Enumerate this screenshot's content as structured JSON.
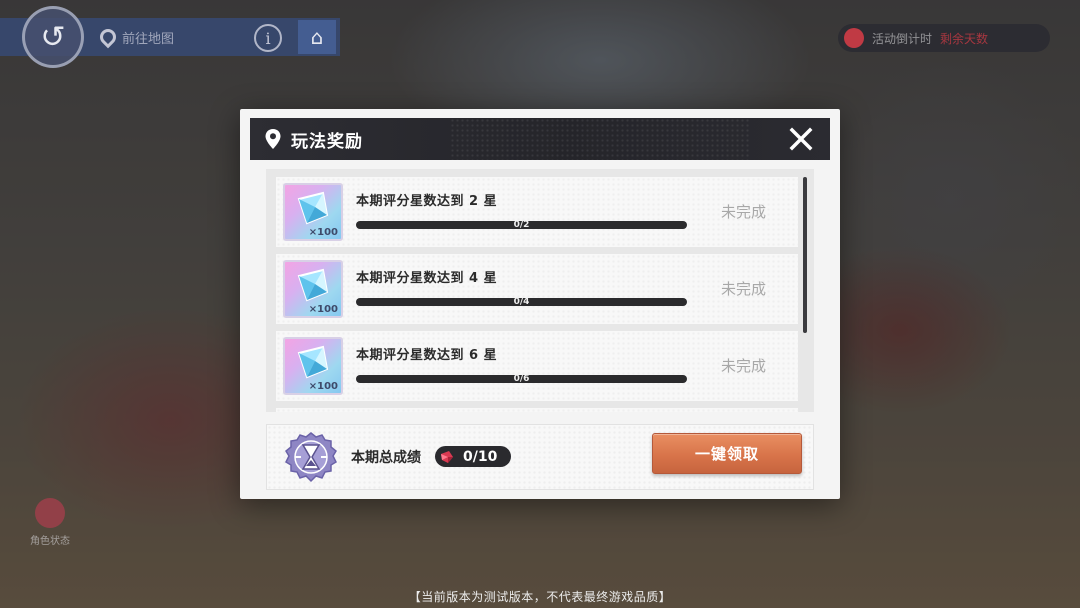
{
  "hud": {
    "location_label": "前往地图",
    "right_label": "活动倒计时",
    "right_highlight": "剩余天数",
    "left_char_label": "角色状态"
  },
  "modal": {
    "title": "玩法奖励",
    "tasks": [
      {
        "text": "本期评分星数达到 2 星",
        "progress_text": "0/2",
        "progress": 0.0,
        "status": "未完成",
        "reward_qty": "×100"
      },
      {
        "text": "本期评分星数达到 4 星",
        "progress_text": "0/4",
        "progress": 0.0,
        "status": "未完成",
        "reward_qty": "×100"
      },
      {
        "text": "本期评分星数达到 6 星",
        "progress_text": "0/6",
        "progress": 0.0,
        "status": "未完成",
        "reward_qty": "×100"
      }
    ],
    "summary": {
      "label": "本期总成绩",
      "score": "0/10",
      "claim_button": "一键领取"
    }
  },
  "footer_note": "【当前版本为测试版本，不代表最终游戏品质】",
  "colors": {
    "header_bg": "#2d2d33",
    "claim_button": "#d8744a",
    "status_gray": "#a8a8a8"
  }
}
